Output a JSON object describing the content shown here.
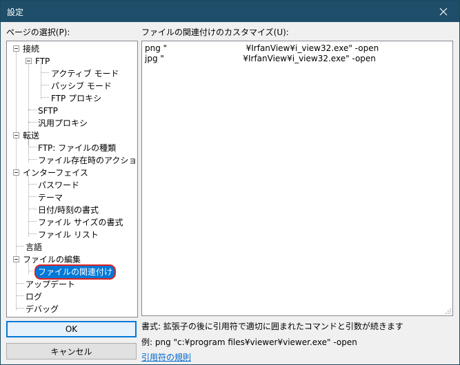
{
  "window": {
    "title": "設定",
    "close_glyph": "✕"
  },
  "left": {
    "page_select_label": "ページの選択(P):",
    "tree": [
      {
        "label": "接続"
      },
      {
        "label": "FTP"
      },
      {
        "label": "アクティブ モード"
      },
      {
        "label": "パッシブ モード"
      },
      {
        "label": "FTP プロキシ"
      },
      {
        "label": "SFTP"
      },
      {
        "label": "汎用プロキシ"
      },
      {
        "label": "転送"
      },
      {
        "label": "FTP: ファイルの種類"
      },
      {
        "label": "ファイル存在時のアクション"
      },
      {
        "label": "インターフェイス"
      },
      {
        "label": "パスワード"
      },
      {
        "label": "テーマ"
      },
      {
        "label": "日付/時刻の書式"
      },
      {
        "label": "ファイル サイズの書式"
      },
      {
        "label": "ファイル リスト"
      },
      {
        "label": "言語"
      },
      {
        "label": "ファイルの編集"
      },
      {
        "label": "ファイルの関連付け"
      },
      {
        "label": "アップデート"
      },
      {
        "label": "ログ"
      },
      {
        "label": "デバッグ"
      }
    ],
    "selected_item": "ファイルの関連付け"
  },
  "right": {
    "assoc_label": "ファイルの関連付けのカスタマイズ(U):",
    "assoc_lines": [
      "png \"                              ¥IrfanView¥i_view32.exe\" -open",
      "jpg \"                              ¥IrfanView¥i_view32.exe\" -open"
    ],
    "format_text": "書式: 拡張子の後に引用符で適切に囲まれたコマンドと引数が続きます",
    "example_text": "例: png \"c:¥program files¥viewer¥viewer.exe\" -open",
    "rules_link": "引用符の規則"
  },
  "buttons": {
    "ok": "OK",
    "cancel": "キャンセル"
  },
  "colors": {
    "titlebar": "#1e4e6a",
    "selection": "#0078d7",
    "highlight_ring": "#e02020",
    "link": "#0066cc"
  }
}
